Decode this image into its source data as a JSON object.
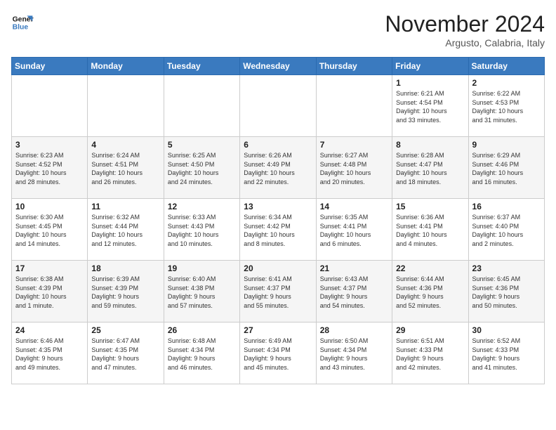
{
  "header": {
    "logo_line1": "General",
    "logo_line2": "Blue",
    "month_title": "November 2024",
    "location": "Argusto, Calabria, Italy"
  },
  "weekdays": [
    "Sunday",
    "Monday",
    "Tuesday",
    "Wednesday",
    "Thursday",
    "Friday",
    "Saturday"
  ],
  "weeks": [
    [
      {
        "day": "",
        "info": ""
      },
      {
        "day": "",
        "info": ""
      },
      {
        "day": "",
        "info": ""
      },
      {
        "day": "",
        "info": ""
      },
      {
        "day": "",
        "info": ""
      },
      {
        "day": "1",
        "info": "Sunrise: 6:21 AM\nSunset: 4:54 PM\nDaylight: 10 hours\nand 33 minutes."
      },
      {
        "day": "2",
        "info": "Sunrise: 6:22 AM\nSunset: 4:53 PM\nDaylight: 10 hours\nand 31 minutes."
      }
    ],
    [
      {
        "day": "3",
        "info": "Sunrise: 6:23 AM\nSunset: 4:52 PM\nDaylight: 10 hours\nand 28 minutes."
      },
      {
        "day": "4",
        "info": "Sunrise: 6:24 AM\nSunset: 4:51 PM\nDaylight: 10 hours\nand 26 minutes."
      },
      {
        "day": "5",
        "info": "Sunrise: 6:25 AM\nSunset: 4:50 PM\nDaylight: 10 hours\nand 24 minutes."
      },
      {
        "day": "6",
        "info": "Sunrise: 6:26 AM\nSunset: 4:49 PM\nDaylight: 10 hours\nand 22 minutes."
      },
      {
        "day": "7",
        "info": "Sunrise: 6:27 AM\nSunset: 4:48 PM\nDaylight: 10 hours\nand 20 minutes."
      },
      {
        "day": "8",
        "info": "Sunrise: 6:28 AM\nSunset: 4:47 PM\nDaylight: 10 hours\nand 18 minutes."
      },
      {
        "day": "9",
        "info": "Sunrise: 6:29 AM\nSunset: 4:46 PM\nDaylight: 10 hours\nand 16 minutes."
      }
    ],
    [
      {
        "day": "10",
        "info": "Sunrise: 6:30 AM\nSunset: 4:45 PM\nDaylight: 10 hours\nand 14 minutes."
      },
      {
        "day": "11",
        "info": "Sunrise: 6:32 AM\nSunset: 4:44 PM\nDaylight: 10 hours\nand 12 minutes."
      },
      {
        "day": "12",
        "info": "Sunrise: 6:33 AM\nSunset: 4:43 PM\nDaylight: 10 hours\nand 10 minutes."
      },
      {
        "day": "13",
        "info": "Sunrise: 6:34 AM\nSunset: 4:42 PM\nDaylight: 10 hours\nand 8 minutes."
      },
      {
        "day": "14",
        "info": "Sunrise: 6:35 AM\nSunset: 4:41 PM\nDaylight: 10 hours\nand 6 minutes."
      },
      {
        "day": "15",
        "info": "Sunrise: 6:36 AM\nSunset: 4:41 PM\nDaylight: 10 hours\nand 4 minutes."
      },
      {
        "day": "16",
        "info": "Sunrise: 6:37 AM\nSunset: 4:40 PM\nDaylight: 10 hours\nand 2 minutes."
      }
    ],
    [
      {
        "day": "17",
        "info": "Sunrise: 6:38 AM\nSunset: 4:39 PM\nDaylight: 10 hours\nand 1 minute."
      },
      {
        "day": "18",
        "info": "Sunrise: 6:39 AM\nSunset: 4:39 PM\nDaylight: 9 hours\nand 59 minutes."
      },
      {
        "day": "19",
        "info": "Sunrise: 6:40 AM\nSunset: 4:38 PM\nDaylight: 9 hours\nand 57 minutes."
      },
      {
        "day": "20",
        "info": "Sunrise: 6:41 AM\nSunset: 4:37 PM\nDaylight: 9 hours\nand 55 minutes."
      },
      {
        "day": "21",
        "info": "Sunrise: 6:43 AM\nSunset: 4:37 PM\nDaylight: 9 hours\nand 54 minutes."
      },
      {
        "day": "22",
        "info": "Sunrise: 6:44 AM\nSunset: 4:36 PM\nDaylight: 9 hours\nand 52 minutes."
      },
      {
        "day": "23",
        "info": "Sunrise: 6:45 AM\nSunset: 4:36 PM\nDaylight: 9 hours\nand 50 minutes."
      }
    ],
    [
      {
        "day": "24",
        "info": "Sunrise: 6:46 AM\nSunset: 4:35 PM\nDaylight: 9 hours\nand 49 minutes."
      },
      {
        "day": "25",
        "info": "Sunrise: 6:47 AM\nSunset: 4:35 PM\nDaylight: 9 hours\nand 47 minutes."
      },
      {
        "day": "26",
        "info": "Sunrise: 6:48 AM\nSunset: 4:34 PM\nDaylight: 9 hours\nand 46 minutes."
      },
      {
        "day": "27",
        "info": "Sunrise: 6:49 AM\nSunset: 4:34 PM\nDaylight: 9 hours\nand 45 minutes."
      },
      {
        "day": "28",
        "info": "Sunrise: 6:50 AM\nSunset: 4:34 PM\nDaylight: 9 hours\nand 43 minutes."
      },
      {
        "day": "29",
        "info": "Sunrise: 6:51 AM\nSunset: 4:33 PM\nDaylight: 9 hours\nand 42 minutes."
      },
      {
        "day": "30",
        "info": "Sunrise: 6:52 AM\nSunset: 4:33 PM\nDaylight: 9 hours\nand 41 minutes."
      }
    ]
  ]
}
